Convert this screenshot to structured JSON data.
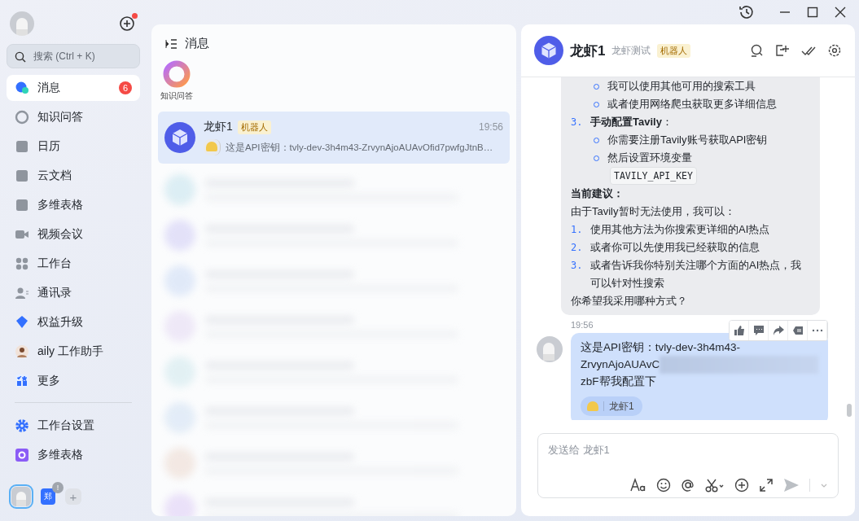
{
  "sidebar": {
    "notification_dot": true,
    "search": {
      "placeholder": "搜索 (Ctrl + K)"
    },
    "items": [
      {
        "label": "消息",
        "selected": true,
        "badge": "6"
      },
      {
        "label": "知识问答",
        "selected": false
      },
      {
        "label": "日历",
        "selected": false
      },
      {
        "label": "云文档",
        "selected": false
      },
      {
        "label": "多维表格",
        "selected": false
      },
      {
        "label": "视频会议",
        "selected": false
      },
      {
        "label": "工作台",
        "selected": false
      },
      {
        "label": "通讯录",
        "selected": false
      },
      {
        "label": "权益升级",
        "selected": false
      },
      {
        "label": "aily 工作助手",
        "selected": false
      },
      {
        "label": "更多",
        "selected": false
      }
    ],
    "pinned": [
      {
        "label": "工作台设置",
        "selected": false
      },
      {
        "label": "多维表格",
        "selected": false
      }
    ],
    "accounts": [
      {
        "kind": "avatar",
        "selected": true
      },
      {
        "kind": "org",
        "text": "郑",
        "alert": "!",
        "selected": false
      },
      {
        "kind": "add",
        "text": "+",
        "selected": false
      }
    ]
  },
  "message_list": {
    "title": "消息",
    "shortcut": {
      "label": "知识问答"
    },
    "chats": [
      {
        "name": "龙虾1",
        "tag": "机器人",
        "time": "19:56",
        "preview": "这是API密钥：tvly-dev-3h4m43-ZrvynAjoAUAvOfid7pwfgJtnB…",
        "selected": true
      }
    ]
  },
  "chat": {
    "title": "龙虾1",
    "subtitle": "龙虾测试",
    "tag": "机器人",
    "bot_message": [
      {
        "kind": "bullet",
        "text": "我可以使用其他可用的搜索工具"
      },
      {
        "kind": "bullet",
        "text": "或者使用网络爬虫获取更多详细信息"
      },
      {
        "kind": "numbered",
        "number": "3.",
        "text": "**手动配置Tavily**："
      },
      {
        "kind": "bullet",
        "text": "你需要注册Tavily账号获取API密钥"
      },
      {
        "kind": "bullet",
        "text": "然后设置环境变量"
      },
      {
        "kind": "code",
        "text": "TAVILY_API_KEY"
      },
      {
        "kind": "heading",
        "text": "当前建议："
      },
      {
        "kind": "para",
        "text": "由于Tavily暂时无法使用，我可以："
      },
      {
        "kind": "numbered",
        "number": "1.",
        "text": "使用其他方法为你搜索更详细的AI热点"
      },
      {
        "kind": "numbered",
        "number": "2.",
        "text": "或者你可以先使用我已经获取的信息"
      },
      {
        "kind": "numbered",
        "number": "3.",
        "text": "或者告诉我你特别关注哪个方面的AI热点，我可以针对性搜索"
      },
      {
        "kind": "para",
        "text": "你希望我采用哪种方式？"
      }
    ],
    "user_message": {
      "time": "19:56",
      "lines": [
        {
          "text": "这是API密钥：tvly-dev-3h4m43-",
          "redacted": false
        },
        {
          "text": "ZrvynAjoAUAvC",
          "redacted": true
        },
        {
          "text": "zbF帮我配置下",
          "redacted": false
        }
      ],
      "reaction": "龙虾1"
    },
    "input": {
      "placeholder": "发送给 龙虾1"
    }
  }
}
